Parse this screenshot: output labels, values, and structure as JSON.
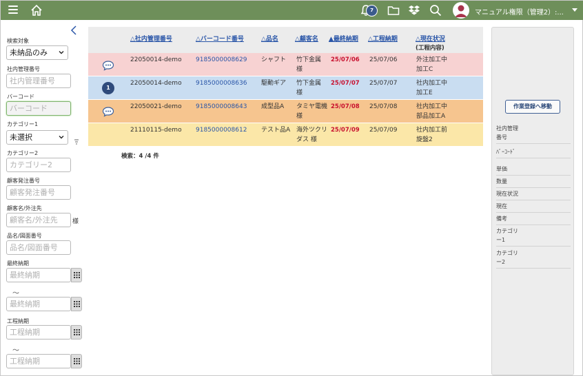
{
  "topbar": {
    "notification_count": "7",
    "user_name": "マニュアル権限（管理2）:..."
  },
  "filters": {
    "collapse_label": "<",
    "search_target_label": "検索対象",
    "search_target_value": "未納品のみ",
    "internal_no_label": "社内管理番号",
    "internal_no_placeholder": "社内管理番号",
    "barcode_label": "バーコード",
    "barcode_placeholder": "バーコード",
    "category1_label": "カテゴリー1",
    "category1_value": "未選択",
    "category2_label": "カテゴリー2",
    "category2_placeholder": "カテゴリー2",
    "customer_order_label": "顧客発注番号",
    "customer_order_placeholder": "顧客発注番号",
    "customer_label": "顧客名/外注先",
    "customer_placeholder": "顧客名/外注先",
    "customer_suffix": "様",
    "item_label": "品名/図面番号",
    "item_placeholder": "品名/図面番号",
    "final_due_label": "最終納期",
    "final_due_from_placeholder": "最終納期",
    "final_due_to_placeholder": "最終納期",
    "process_due_label": "工程納期",
    "process_due_from_placeholder": "工程納期",
    "process_due_to_placeholder": "工程納期",
    "range_sep": "〜"
  },
  "table": {
    "headers": {
      "internal_no": "△社内管理番号",
      "barcode": "△バーコード番号",
      "item": "△品名",
      "customer": "△顧客名",
      "final_due": "▲最終納期",
      "process_due": "△工程納期",
      "status": "△現在状況",
      "status_sub": "(工程内容)"
    },
    "rows": [
      {
        "internal_no": "22050014-demo",
        "barcode": "9185000008629",
        "item": "シャフト",
        "customer_1": "竹下金属",
        "customer_2": "様",
        "final_due": "25/07/06",
        "process_due": "25/07/06",
        "status_1": "外注加工中",
        "status_2": "加工C",
        "marker": "chat",
        "bg": "#f7d2d2"
      },
      {
        "internal_no": "22050014-demo",
        "barcode": "9185000008636",
        "item": "駆動ギア",
        "customer_1": "竹下金属",
        "customer_2": "様",
        "final_due": "25/07/07",
        "process_due": "25/07/07",
        "status_1": "社内加工中",
        "status_2": "加工E",
        "marker": "1",
        "bg": "#c9ddf1"
      },
      {
        "internal_no": "22050021-demo",
        "barcode": "9185000008643",
        "item": "成型品A",
        "customer_1": "タミヤ電機",
        "customer_2": "様",
        "final_due": "25/07/08",
        "process_due": "25/07/08",
        "status_1": "社内加工中",
        "status_2": "部品加工A",
        "marker": "chat",
        "bg": "#f6c58f"
      },
      {
        "internal_no": "21110115-demo",
        "barcode": "9185000008612",
        "item": "テスト品A",
        "customer_1": "海外ツクリ",
        "customer_2": "ダス 様",
        "final_due": "25/07/09",
        "process_due": "25/07/09",
        "status_1": "社内加工前",
        "status_2": "旋盤2",
        "marker": "",
        "bg": "#fbe7a8"
      }
    ],
    "count_text": "検索：4 /4 件"
  },
  "detail": {
    "move_button": "作業登録へ移動",
    "fields": [
      {
        "l1": "社内管理",
        "l2": "番号"
      },
      {
        "l1": "ﾊﾞｰｺｰﾄﾞ",
        "l2": ""
      },
      {
        "l1": "単価",
        "l2": ""
      },
      {
        "l1": "数量",
        "l2": ""
      },
      {
        "l1": "現在状況",
        "l2": ""
      },
      {
        "l1": "現在",
        "l2": ""
      },
      {
        "l1": "備考",
        "l2": ""
      },
      {
        "l1": "カテゴリ",
        "l2": "ー1"
      },
      {
        "l1": "カテゴリ",
        "l2": "ー2"
      }
    ]
  },
  "colors": {
    "topbar": "#6e8f5a",
    "link": "#2a56a8",
    "due_date": "#c8102e"
  }
}
